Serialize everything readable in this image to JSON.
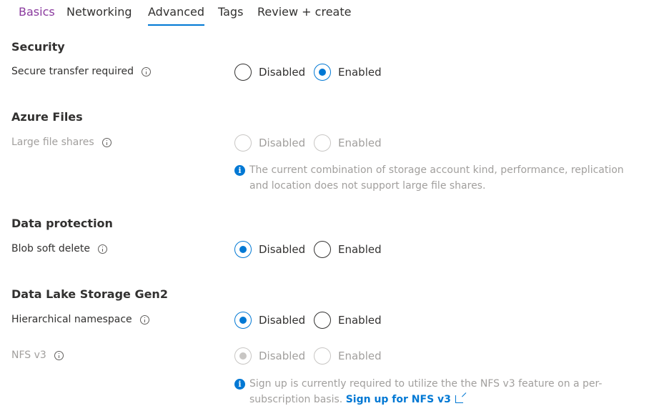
{
  "tabs": [
    {
      "label": "Basics",
      "state": "visited"
    },
    {
      "label": "Networking",
      "state": "normal"
    },
    {
      "label": "Advanced",
      "state": "active"
    },
    {
      "label": "Tags",
      "state": "normal"
    },
    {
      "label": "Review + create",
      "state": "normal"
    }
  ],
  "sections": {
    "security": {
      "title": "Security",
      "secure_transfer": {
        "label": "Secure transfer required",
        "options": [
          "Disabled",
          "Enabled"
        ],
        "selected": "Enabled"
      }
    },
    "azure_files": {
      "title": "Azure Files",
      "large_file_shares": {
        "label": "Large file shares",
        "options": [
          "Disabled",
          "Enabled"
        ],
        "selected": null,
        "disabled": true
      },
      "notice": "The current combination of storage account kind, performance, replication and location does not support large file shares."
    },
    "data_protection": {
      "title": "Data protection",
      "blob_soft_delete": {
        "label": "Blob soft delete",
        "options": [
          "Disabled",
          "Enabled"
        ],
        "selected": "Disabled"
      }
    },
    "data_lake": {
      "title": "Data Lake Storage Gen2",
      "hierarchical_namespace": {
        "label": "Hierarchical namespace",
        "options": [
          "Disabled",
          "Enabled"
        ],
        "selected": "Disabled"
      },
      "nfs_v3": {
        "label": "NFS v3",
        "options": [
          "Disabled",
          "Enabled"
        ],
        "selected": "Disabled",
        "disabled": true
      },
      "notice": "Sign up is currently required to utilize the the NFS v3 feature on a per-subscription basis.",
      "signup_link": "Sign up for NFS v3"
    }
  },
  "icons": {
    "info": "info-icon",
    "external": "external-link-icon"
  },
  "colors": {
    "accent": "#0078d4",
    "visited_tab": "#8a3a9e",
    "disabled_text": "#a19f9d"
  }
}
